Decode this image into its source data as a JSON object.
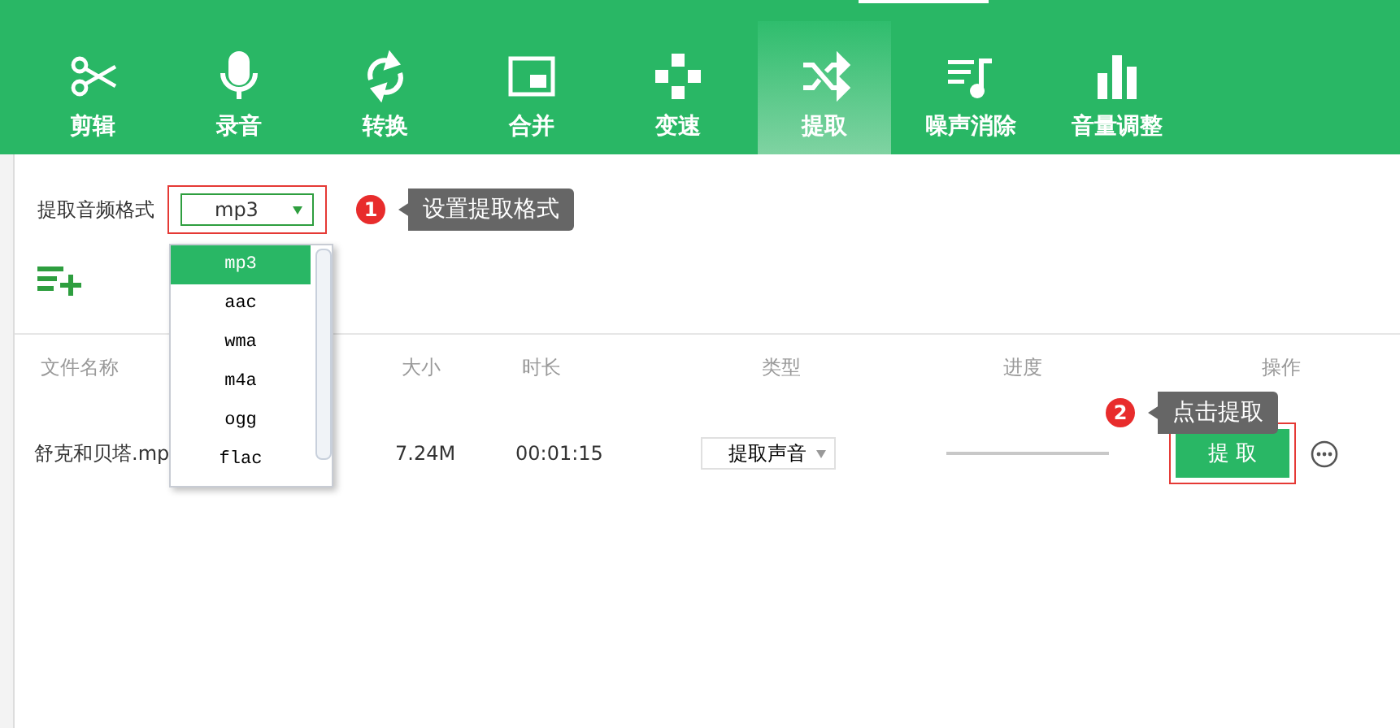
{
  "tabs": [
    {
      "label": "剪辑",
      "selected": false
    },
    {
      "label": "录音",
      "selected": false
    },
    {
      "label": "转换",
      "selected": false
    },
    {
      "label": "合并",
      "selected": false
    },
    {
      "label": "变速",
      "selected": false
    },
    {
      "label": "提取",
      "selected": true
    },
    {
      "label": "噪声消除",
      "selected": false
    },
    {
      "label": "音量调整",
      "selected": false
    }
  ],
  "format": {
    "label": "提取音频格式",
    "value": "mp3",
    "options": [
      {
        "label": "mp3",
        "selected": true
      },
      {
        "label": "aac",
        "selected": false
      },
      {
        "label": "wma",
        "selected": false
      },
      {
        "label": "m4a",
        "selected": false
      },
      {
        "label": "ogg",
        "selected": false
      },
      {
        "label": "flac",
        "selected": false
      }
    ]
  },
  "steps": [
    {
      "number": "1",
      "text": "设置提取格式"
    },
    {
      "number": "2",
      "text": "点击提取"
    }
  ],
  "table": {
    "columns": [
      "文件名称",
      "大小",
      "时长",
      "类型",
      "进度",
      "操作"
    ],
    "rows": [
      {
        "name": "舒克和贝塔.mp",
        "size": "7.24M",
        "duration": "00:01:15",
        "type": "提取声音",
        "action": "提 取"
      }
    ]
  }
}
